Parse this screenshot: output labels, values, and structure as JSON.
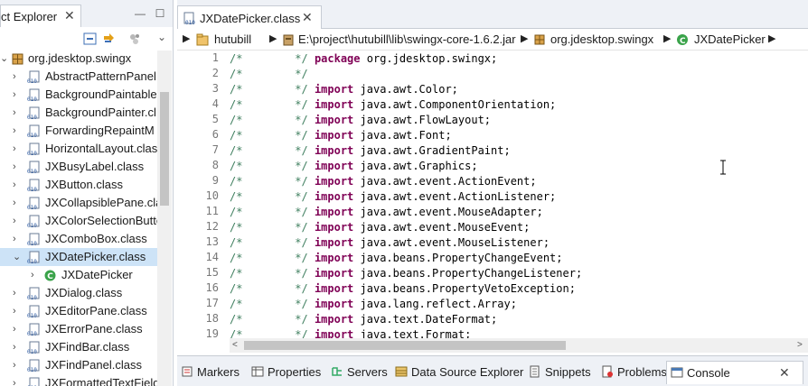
{
  "left_panel": {
    "tab_label": "ct Explorer",
    "items": [
      {
        "label": "org.jdesktop.swingx",
        "kind": "package",
        "expanded": true
      },
      {
        "label": "AbstractPatternPanel.",
        "kind": "class"
      },
      {
        "label": "BackgroundPaintable",
        "kind": "class"
      },
      {
        "label": "BackgroundPainter.cl",
        "kind": "class"
      },
      {
        "label": "ForwardingRepaintM",
        "kind": "class"
      },
      {
        "label": "HorizontalLayout.clas",
        "kind": "class"
      },
      {
        "label": "JXBusyLabel.class",
        "kind": "class"
      },
      {
        "label": "JXButton.class",
        "kind": "class"
      },
      {
        "label": "JXCollapsiblePane.cla",
        "kind": "class"
      },
      {
        "label": "JXColorSelectionButte",
        "kind": "class"
      },
      {
        "label": "JXComboBox.class",
        "kind": "class"
      },
      {
        "label": "JXDatePicker.class",
        "kind": "class",
        "selected": true,
        "expanded": true
      },
      {
        "label": "JXDatePicker",
        "kind": "type"
      },
      {
        "label": "JXDialog.class",
        "kind": "class"
      },
      {
        "label": "JXEditorPane.class",
        "kind": "class"
      },
      {
        "label": "JXErrorPane.class",
        "kind": "class"
      },
      {
        "label": "JXFindBar.class",
        "kind": "class"
      },
      {
        "label": "JXFindPanel.class",
        "kind": "class"
      },
      {
        "label": "JXFormattedTextField",
        "kind": "class"
      }
    ]
  },
  "editor": {
    "tab_label": "JXDatePicker.class",
    "breadcrumb": [
      "hutubill",
      "E:\\project\\hutubill\\lib\\swingx-core-1.6.2.jar",
      "org.jdesktop.swingx",
      "JXDatePicker"
    ],
    "lines": [
      {
        "num": "1",
        "c1": "/*",
        "c2": "*/",
        "kw": "package",
        "rest": "org.jdesktop.swingx;"
      },
      {
        "num": "2",
        "c1": "/*",
        "c2": "*/",
        "kw": "",
        "rest": ""
      },
      {
        "num": "3",
        "c1": "/*",
        "c2": "*/",
        "kw": "import",
        "rest": "java.awt.Color;"
      },
      {
        "num": "4",
        "c1": "/*",
        "c2": "*/",
        "kw": "import",
        "rest": "java.awt.ComponentOrientation;"
      },
      {
        "num": "5",
        "c1": "/*",
        "c2": "*/",
        "kw": "import",
        "rest": "java.awt.FlowLayout;"
      },
      {
        "num": "6",
        "c1": "/*",
        "c2": "*/",
        "kw": "import",
        "rest": "java.awt.Font;"
      },
      {
        "num": "7",
        "c1": "/*",
        "c2": "*/",
        "kw": "import",
        "rest": "java.awt.GradientPaint;"
      },
      {
        "num": "8",
        "c1": "/*",
        "c2": "*/",
        "kw": "import",
        "rest": "java.awt.Graphics;"
      },
      {
        "num": "9",
        "c1": "/*",
        "c2": "*/",
        "kw": "import",
        "rest": "java.awt.event.ActionEvent;"
      },
      {
        "num": "10",
        "c1": "/*",
        "c2": "*/",
        "kw": "import",
        "rest": "java.awt.event.ActionListener;"
      },
      {
        "num": "11",
        "c1": "/*",
        "c2": "*/",
        "kw": "import",
        "rest": "java.awt.event.MouseAdapter;"
      },
      {
        "num": "12",
        "c1": "/*",
        "c2": "*/",
        "kw": "import",
        "rest": "java.awt.event.MouseEvent;"
      },
      {
        "num": "13",
        "c1": "/*",
        "c2": "*/",
        "kw": "import",
        "rest": "java.awt.event.MouseListener;"
      },
      {
        "num": "14",
        "c1": "/*",
        "c2": "*/",
        "kw": "import",
        "rest": "java.beans.PropertyChangeEvent;"
      },
      {
        "num": "15",
        "c1": "/*",
        "c2": "*/",
        "kw": "import",
        "rest": "java.beans.PropertyChangeListener;"
      },
      {
        "num": "16",
        "c1": "/*",
        "c2": "*/",
        "kw": "import",
        "rest": "java.beans.PropertyVetoException;"
      },
      {
        "num": "17",
        "c1": "/*",
        "c2": "*/",
        "kw": "import",
        "rest": "java.lang.reflect.Array;"
      },
      {
        "num": "18",
        "c1": "/*",
        "c2": "*/",
        "kw": "import",
        "rest": "java.text.DateFormat;"
      },
      {
        "num": "19",
        "c1": "/*",
        "c2": "*/",
        "kw": "import",
        "rest": "java.text.Format;"
      }
    ]
  },
  "bottom_tabs": [
    {
      "label": "Markers",
      "icon": "markers-icon"
    },
    {
      "label": "Properties",
      "icon": "properties-icon"
    },
    {
      "label": "Servers",
      "icon": "servers-icon"
    },
    {
      "label": "Data Source Explorer",
      "icon": "data-source-icon"
    },
    {
      "label": "Snippets",
      "icon": "snippets-icon"
    },
    {
      "label": "Problems",
      "icon": "problems-icon"
    },
    {
      "label": "Console",
      "icon": "console-icon",
      "active": true
    }
  ],
  "colors": {
    "comment": "#3f7f5f",
    "keyword": "#7f0055",
    "selection": "#cde3f7",
    "line_number": "#787878"
  }
}
